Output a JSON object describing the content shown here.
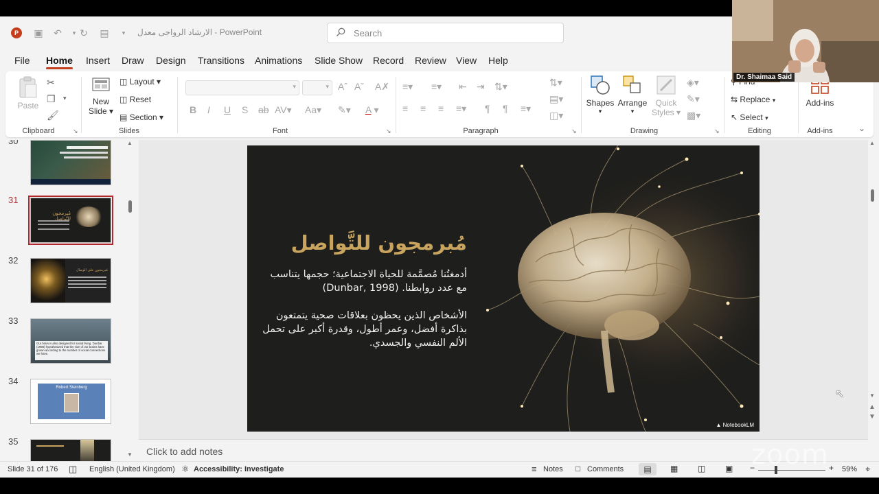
{
  "app": {
    "title": "الارشاد الرواجى معدل  -  PowerPoint",
    "search_placeholder": "Search"
  },
  "tabs": [
    "File",
    "Home",
    "Insert",
    "Draw",
    "Design",
    "Transitions",
    "Animations",
    "Slide Show",
    "Record",
    "Review",
    "View",
    "Help"
  ],
  "ribbon": {
    "clipboard": {
      "paste": "Paste",
      "label": "Clipboard"
    },
    "slides": {
      "new_slide": "New",
      "new_slide_2": "Slide",
      "layout": "Layout",
      "reset": "Reset",
      "section": "Section",
      "label": "Slides"
    },
    "font": {
      "label": "Font"
    },
    "paragraph": {
      "label": "Paragraph"
    },
    "drawing": {
      "shapes": "Shapes",
      "arrange": "Arrange",
      "quick_styles": "Quick",
      "quick_styles_2": "Styles",
      "label": "Drawing"
    },
    "editing": {
      "find": "Find",
      "replace": "Replace",
      "select": "Select",
      "label": "Editing"
    },
    "addins": {
      "addins": "Add-ins",
      "label": "Add-ins"
    }
  },
  "thumbnails": [
    {
      "num": "30",
      "caption": ""
    },
    {
      "num": "31",
      "caption": "مُبرمجون للتَّواصل"
    },
    {
      "num": "32",
      "caption": "مُبرمجون على الوصال"
    },
    {
      "num": "33",
      "caption": "Our brain is also designed for social living. Dunbar (1998) hypothesized that the size of our brains have grown according to the number of social connections we have."
    },
    {
      "num": "34",
      "caption": "Robert Steinberg"
    },
    {
      "num": "35",
      "caption": ""
    }
  ],
  "slide": {
    "title": "مُبرمجون للتَّواصل",
    "para1": "أدمغتُنا مُصمَّمة للحياة الاجتماعية؛ حجمها يتناسب مع عدد روابطنا. (Dunbar, 1998)",
    "para2": "الأشخاص الذين يحظون بعلاقات صحية يتمتعون بذاكرة أفضل، وعمر أطول، وقدرة أكبر على تحمل الألم النفسي والجسدي.",
    "watermark": "NotebookLM"
  },
  "notes": {
    "placeholder": "Click to add notes"
  },
  "status": {
    "slide": "Slide 31 of 176",
    "language": "English (United Kingdom)",
    "accessibility": "Accessibility: Investigate",
    "notes": "Notes",
    "comments": "Comments",
    "zoom": "59%"
  },
  "webcam": {
    "name": "Dr. Shaimaa Said",
    "watermark": "zoom"
  },
  "colors": {
    "accent": "#c43e1c",
    "slide_bg": "#1d1d1b",
    "slide_title": "#c9a45e",
    "selected_thumb": "#b3282d"
  }
}
